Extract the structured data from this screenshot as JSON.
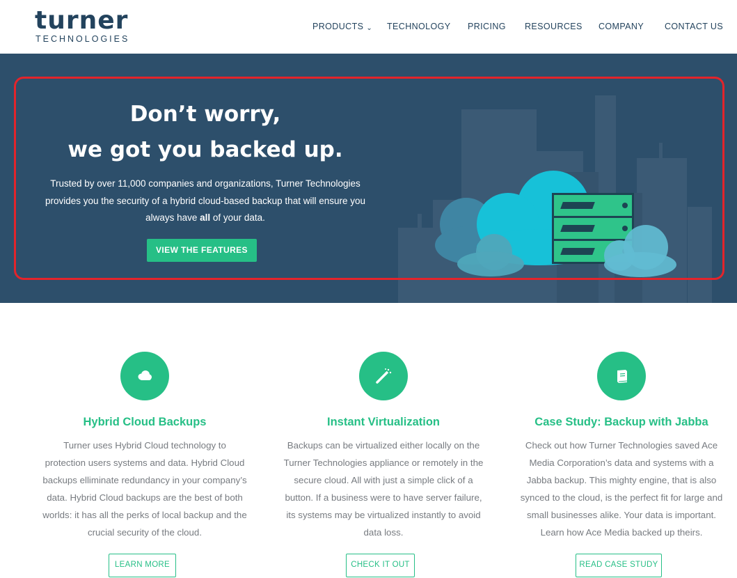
{
  "brand": {
    "name": "turner",
    "tagline": "TECHNOLOGIES"
  },
  "nav": {
    "items": [
      {
        "label": "PRODUCTS",
        "has_dropdown": true
      },
      {
        "label": "TECHNOLOGY"
      },
      {
        "label": "PRICING"
      },
      {
        "label": "RESOURCES"
      },
      {
        "label": "COMPANY"
      },
      {
        "label": "CONTACT US"
      }
    ]
  },
  "hero": {
    "title_line1": "Don’t worry,",
    "title_line2": "we got you backed up.",
    "text_line1": "Trusted by over 11,000 companies and organizations, Turner Technologies",
    "text_line2": "provides you the security of a hybrid cloud-based backup that will ensure you",
    "text_line3_before": "always have ",
    "text_line3_bold": "all",
    "text_line3_after": " of your data.",
    "cta_label": "VIEW THE FEATURES"
  },
  "features": [
    {
      "icon": "cloud-icon",
      "title": "Hybrid Cloud Backups",
      "lines": [
        "Turner uses Hybrid Cloud technology to",
        "protection users systems and data.  Hybrid Cloud",
        "backups elliminate redundancy in your company’s",
        "data. Hybrid Cloud backups are the best of both",
        "worlds: it has all the perks of local backup and the",
        "crucial security of the cloud."
      ],
      "button": "LEARN MORE"
    },
    {
      "icon": "magic-wand-icon",
      "title": "Instant Virtualization",
      "lines": [
        "Backups can be virtualized either locally on the",
        "Turner Technologies appliance or remotely in the",
        "secure cloud. All with just a simple click of a",
        "button. If a business were to have server failure,",
        "its systems may be virtualized instantly to avoid",
        "data loss."
      ],
      "button": "CHECK IT OUT"
    },
    {
      "icon": "book-icon",
      "title": "Case Study: Backup with Jabba",
      "lines": [
        "Check out how Turner Technologies saved Ace",
        "Media Corporation’s data and systems with a",
        "Jabba backup. This mighty engine, that is also",
        "synced to the cloud, is the perfect fit for large and",
        "small businesses alike. Your data is important.",
        "Learn how Ace Media backed up theirs."
      ],
      "button": "READ CASE STUDY"
    }
  ],
  "colors": {
    "brand_navy": "#23435d",
    "hero_bg": "#2d4f6b",
    "accent_green": "#26bf86",
    "highlight_red": "#e3242b",
    "body_text": "#777b80"
  }
}
